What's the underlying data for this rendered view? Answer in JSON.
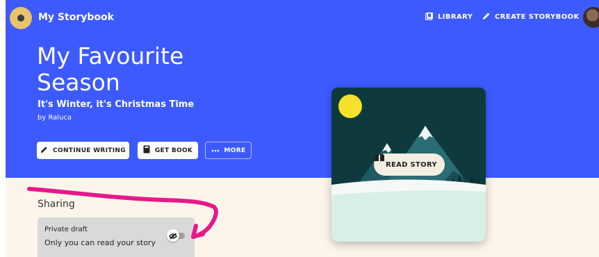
{
  "app": {
    "title": "My Storybook",
    "nav": {
      "library": "LIBRARY",
      "create": "CREATE STORYBOOK"
    }
  },
  "story": {
    "title": "My Favourite Season",
    "subtitle": "It's Winter, it's Christmas Time",
    "byline": "by Raluca"
  },
  "actions": {
    "continue_writing": "CONTINUE WRITING",
    "get_book": "GET BOOK",
    "more": "MORE"
  },
  "book_card": {
    "read_story": "READ STORY"
  },
  "sharing": {
    "heading": "Sharing",
    "privacy_label": "Private draft",
    "privacy_description": "Only you can read your story",
    "is_private": true
  },
  "colors": {
    "hero": "#3d5afe",
    "lower_background": "#fdf5ea",
    "annotation": "#e6198a"
  }
}
